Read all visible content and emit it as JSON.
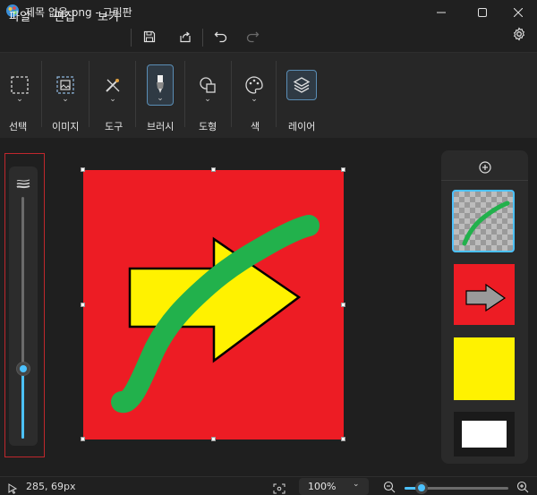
{
  "window": {
    "title": "제목 없음.png - 그림판",
    "controls": {
      "minimize": "minimize-icon",
      "maximize": "maximize-icon",
      "close": "close-icon"
    }
  },
  "menu": {
    "file": "파일",
    "edit": "편집",
    "view": "보기",
    "icons": [
      "save-icon",
      "share-icon",
      "undo-icon",
      "redo-icon",
      "settings-icon"
    ]
  },
  "toolbar": {
    "groups": [
      {
        "label": "선택",
        "icon": "selection-icon",
        "active": false
      },
      {
        "label": "이미지",
        "icon": "image-icon",
        "active": false
      },
      {
        "label": "도구",
        "icon": "tools-icon",
        "active": false
      },
      {
        "label": "브러시",
        "icon": "brush-icon",
        "active": true
      },
      {
        "label": "도형",
        "icon": "shapes-icon",
        "active": false
      },
      {
        "label": "색",
        "icon": "palette-icon",
        "active": false
      },
      {
        "label": "레이어",
        "icon": "layers-icon",
        "active": true
      }
    ]
  },
  "brush_size": {
    "level": 0.29,
    "icon": "brush-size-icon"
  },
  "layers": {
    "add_icon": "add-layer-icon",
    "items": [
      {
        "name": "layer-stroke",
        "content": "green stroke on transparent",
        "selected": true
      },
      {
        "name": "layer-arrow",
        "content": "arrow on red",
        "selected": false
      },
      {
        "name": "layer-yellow",
        "content": "yellow fill",
        "selected": false
      },
      {
        "name": "layer-white",
        "content": "white",
        "selected": false
      }
    ]
  },
  "colors": {
    "canvas_red": "#ed1c24",
    "arrow_yellow": "#fff200",
    "stroke_green": "#22b14c",
    "accent": "#4cc2ff"
  },
  "status": {
    "cursor_position": "285, 69px",
    "zoom": "100%",
    "zoom_level": 0.1
  }
}
